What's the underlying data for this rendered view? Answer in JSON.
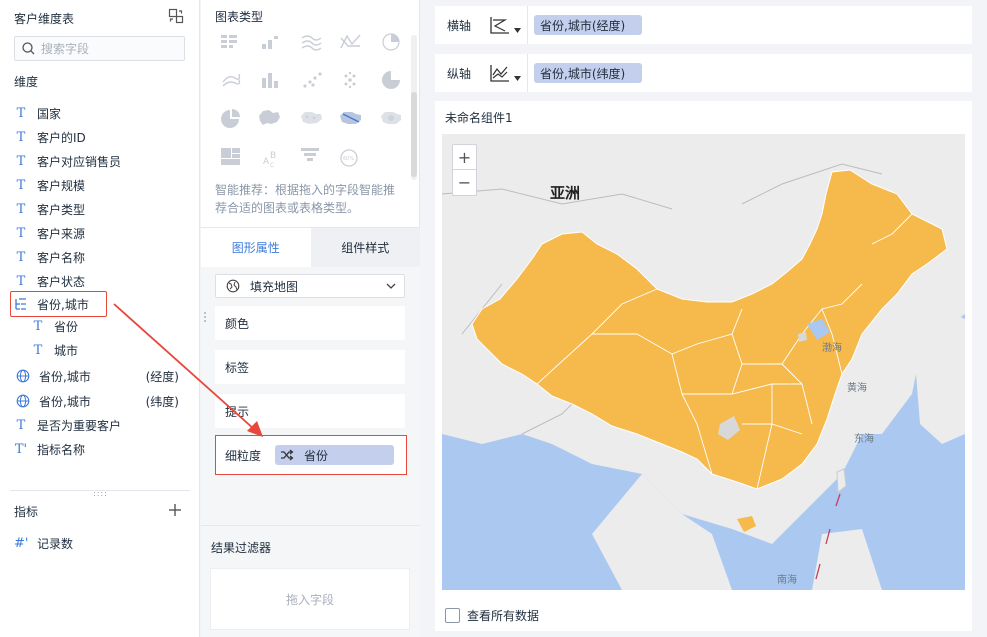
{
  "left_panel": {
    "title": "客户维度表",
    "search_placeholder": "搜索字段",
    "dimension_header": "维度",
    "dimensions": [
      {
        "label": "国家",
        "type": "T"
      },
      {
        "label": "客户的ID",
        "type": "T"
      },
      {
        "label": "客户对应销售员",
        "type": "T"
      },
      {
        "label": "客户规模",
        "type": "T"
      },
      {
        "label": "客户类型",
        "type": "T"
      },
      {
        "label": "客户来源",
        "type": "T"
      },
      {
        "label": "客户名称",
        "type": "T"
      },
      {
        "label": "客户状态",
        "type": "T"
      }
    ],
    "hierarchy": {
      "label": "省份,城市",
      "children": [
        "省份",
        "城市"
      ]
    },
    "geo_fields": [
      {
        "label": "省份,城市",
        "suffix": "(经度)"
      },
      {
        "label": "省份,城市",
        "suffix": "(纬度)"
      }
    ],
    "more_dimensions": [
      {
        "label": "是否为重要客户",
        "type": "T"
      },
      {
        "label": "指标名称",
        "type": "T'"
      }
    ],
    "measure_header": "指标",
    "measures": [
      {
        "label": "记录数",
        "type": "#'"
      }
    ]
  },
  "middle_panel": {
    "chart_type_header": "图表类型",
    "smart_tip": "智能推荐：根据拖入的字段智能推荐合适的图表或表格类型。",
    "tabs": [
      {
        "label": "图形属性",
        "active": true
      },
      {
        "label": "组件样式",
        "active": false
      }
    ],
    "map_type": "填充地图",
    "properties": [
      "颜色",
      "标签",
      "提示"
    ],
    "granularity_label": "细粒度",
    "granularity_value": "省份",
    "filter_header": "结果过滤器",
    "filter_placeholder": "拖入字段"
  },
  "right_area": {
    "x_axis_label": "横轴",
    "x_axis_value": "省份,城市(经度)",
    "y_axis_label": "纵轴",
    "y_axis_value": "省份,城市(纬度)",
    "widget_title": "未命名组件1",
    "map_labels": {
      "continent": "亚洲",
      "bohai": "渤海",
      "yellow_sea": "黄海",
      "east_sea": "东海",
      "south_sea": "南海"
    },
    "zoom_in": "+",
    "zoom_out": "−",
    "view_all_label": "查看所有数据"
  },
  "colors": {
    "accent": "#3d7bd9",
    "pill": "#c3cfec",
    "highlight": "#e8473b",
    "map_fill": "#f6b94b",
    "water": "#aac8f0",
    "land": "#ececec"
  }
}
